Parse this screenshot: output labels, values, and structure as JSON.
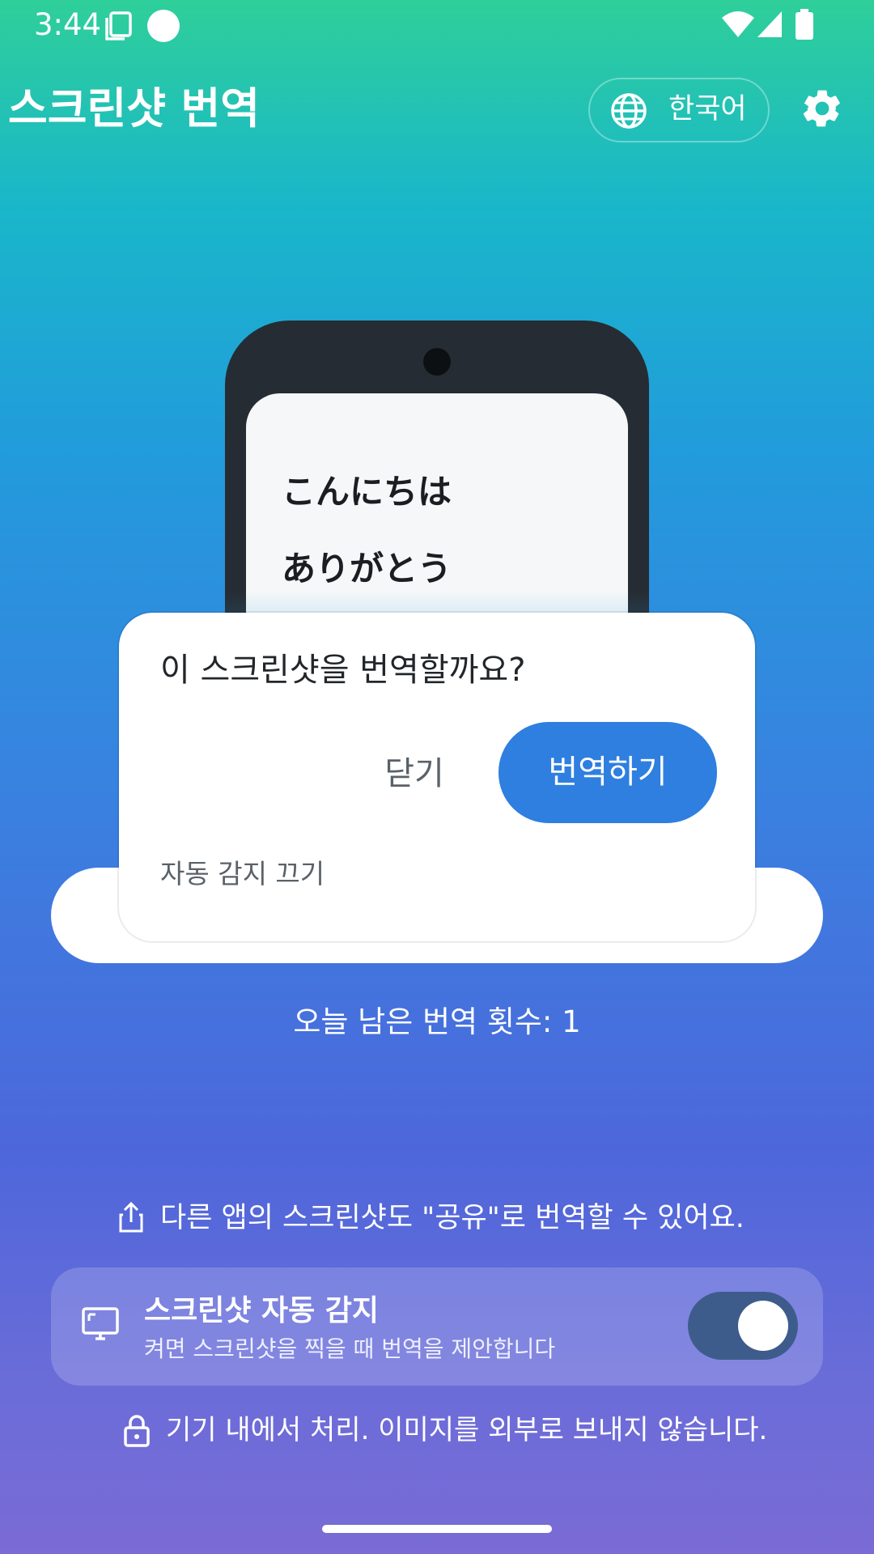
{
  "status_bar": {
    "time": "3:44",
    "icons": [
      "notification-copy-icon",
      "circle-indicator-icon",
      "wifi-icon",
      "signal-icon",
      "battery-icon"
    ]
  },
  "header": {
    "title": "스크린샷 번역",
    "language_label": "한국어",
    "icons": [
      "globe-icon",
      "gear-icon"
    ]
  },
  "illustration": {
    "lines": [
      "こんにちは",
      "ありがとう"
    ]
  },
  "dialog": {
    "title": "이 스크린샷을 번역할까요?",
    "close_label": "닫기",
    "translate_label": "번역하기",
    "auto_detect_off_label": "자동 감지 끄기"
  },
  "remaining_text": "오늘 남은 번역 횟수: 1",
  "share_hint": "다른 앱의 스크린샷도 \"공유\"로 번역할 수 있어요.",
  "auto_detect": {
    "title": "스크린샷 자동 감지",
    "subtitle": "켜면 스크린샷을 찍을 때 번역을 제안합니다",
    "enabled": true
  },
  "privacy_note": "기기 내에서 처리. 이미지를 외부로 보내지 않습니다.",
  "colors": {
    "accent": "#2e7fe0",
    "toggle_track": "#3d5c8c",
    "gradient_top": "#2fcf9a",
    "gradient_bottom": "#7a6bd6"
  }
}
